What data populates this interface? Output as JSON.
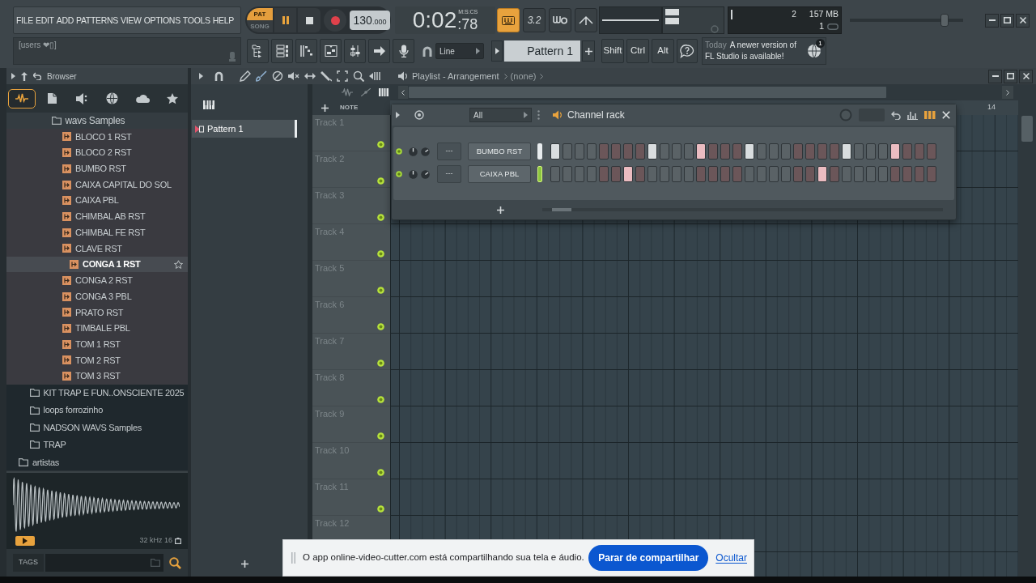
{
  "menu": [
    "FILE",
    "EDIT",
    "ADD",
    "PATTERNS",
    "VIEW",
    "OPTIONS",
    "TOOLS",
    "HELP"
  ],
  "hint_bar": {
    "text": "[users ❤▯]"
  },
  "transport": {
    "modes": [
      {
        "label": "PAT",
        "selected": true
      },
      {
        "label": "SONG",
        "selected": false
      }
    ],
    "playing": true,
    "recording": false,
    "tempo": "130",
    "tempo_fraction": ".000"
  },
  "time": {
    "value": "0:02",
    "fraction": ":78",
    "format": "M:S:CS"
  },
  "record_options": [
    {
      "kind": "keyboard",
      "on": true
    },
    {
      "kind": "countdown",
      "label": "3.2",
      "on": false
    },
    {
      "kind": "blend",
      "on": false
    },
    {
      "kind": "loop",
      "on": false
    }
  ],
  "monitor": {
    "cpu": "2",
    "memory": "157 MB",
    "polyphony": "1"
  },
  "master_volume": {
    "level": 0.86
  },
  "snap": {
    "value": "Line"
  },
  "pattern_selector": {
    "value": "Pattern 1"
  },
  "modifier_keys": [
    "Shift",
    "Ctrl",
    "Alt"
  ],
  "news": {
    "day": "Today",
    "message_lines": [
      "A newer version of",
      "FL Studio is available!"
    ],
    "count": "1"
  },
  "browser": {
    "title": "Browser",
    "tabs": [
      {
        "kind": "all",
        "selected": true
      },
      {
        "kind": "files",
        "selected": false
      },
      {
        "kind": "plugins",
        "selected": false
      },
      {
        "kind": "online",
        "selected": false
      },
      {
        "kind": "cloud",
        "selected": false
      },
      {
        "kind": "favorites",
        "selected": false
      }
    ],
    "tree": [
      {
        "children": [
          {
            "children": [
              {
                "children": [
                  {
                    "name": "wavs Samples",
                    "kind": "folder",
                    "selected": false,
                    "children": [
                      {
                        "name": "BLOCO 1 RST",
                        "kind": "audio",
                        "selected": false
                      },
                      {
                        "name": "BLOCO 2 RST",
                        "kind": "audio",
                        "selected": false
                      },
                      {
                        "name": "BUMBO RST",
                        "kind": "audio",
                        "selected": false
                      },
                      {
                        "name": "CAIXA CAPITAL DO SOL",
                        "kind": "audio",
                        "selected": false
                      },
                      {
                        "name": "CAIXA PBL",
                        "kind": "audio",
                        "selected": false
                      },
                      {
                        "name": "CHIMBAL AB RST",
                        "kind": "audio",
                        "selected": false
                      },
                      {
                        "name": "CHIMBAL FE RST",
                        "kind": "audio",
                        "selected": false
                      },
                      {
                        "name": "CLAVE RST",
                        "kind": "audio",
                        "selected": false
                      },
                      {
                        "name": "CONGA 1 RST",
                        "kind": "audio",
                        "selected": true
                      },
                      {
                        "name": "CONGA 2 RST",
                        "kind": "audio",
                        "selected": false
                      },
                      {
                        "name": "CONGA 3 PBL",
                        "kind": "audio",
                        "selected": false
                      },
                      {
                        "name": "PRATO RST",
                        "kind": "audio",
                        "selected": false
                      },
                      {
                        "name": "TIMBALE PBL",
                        "kind": "audio",
                        "selected": false
                      },
                      {
                        "name": "TOM 1 RST",
                        "kind": "audio",
                        "selected": false
                      },
                      {
                        "name": "TOM 2 RST",
                        "kind": "audio",
                        "selected": false
                      },
                      {
                        "name": "TOM 3 RST",
                        "kind": "audio",
                        "selected": false
                      }
                    ]
                  }
                ]
              }
            ]
          },
          {
            "name": "KIT TRAP E FUN..ONSCIENTE 2025",
            "kind": "folder",
            "selected": false
          },
          {
            "name": "loops forrozinho",
            "kind": "folder",
            "selected": false
          },
          {
            "name": "NADSON WAVS Samples",
            "kind": "folder",
            "selected": false
          },
          {
            "name": "TRAP",
            "kind": "folder",
            "selected": false
          }
        ]
      },
      {
        "name": "artistas",
        "kind": "folder",
        "selected": false
      }
    ]
  },
  "preview": {
    "info": "32 kHz 16"
  },
  "tags": {
    "label": "TAGS"
  },
  "patterns": [
    {
      "name": "Pattern 1",
      "selected": true
    }
  ],
  "playlist": {
    "title": "Playlist - Arrangement",
    "clip": "(none)",
    "header_label": "NOTE",
    "ruler": [
      "14"
    ],
    "tracks": [
      {
        "name": "Track 1",
        "enabled": true
      },
      {
        "name": "Track 2",
        "enabled": true
      },
      {
        "name": "Track 3",
        "enabled": true
      },
      {
        "name": "Track 4",
        "enabled": true
      },
      {
        "name": "Track 5",
        "enabled": true
      },
      {
        "name": "Track 6",
        "enabled": true
      },
      {
        "name": "Track 7",
        "enabled": true
      },
      {
        "name": "Track 8",
        "enabled": true
      },
      {
        "name": "Track 9",
        "enabled": true
      },
      {
        "name": "Track 10",
        "enabled": true
      },
      {
        "name": "Track 11",
        "enabled": true
      },
      {
        "name": "Track 12"
      }
    ]
  },
  "channel_rack": {
    "title": "Channel rack",
    "filter": "All",
    "channels": [
      {
        "name": "BUMBO RST",
        "on": true,
        "mixer_track": "---",
        "selected": false,
        "steps": [
          true,
          false,
          false,
          false,
          false,
          false,
          false,
          false,
          true,
          false,
          false,
          false,
          true,
          false,
          false,
          false,
          true,
          false,
          false,
          false,
          false,
          false,
          false,
          false,
          true,
          false,
          false,
          false,
          true,
          false,
          false,
          false
        ]
      },
      {
        "name": "CAIXA PBL",
        "on": true,
        "mixer_track": "---",
        "selected": true,
        "steps": [
          false,
          false,
          false,
          false,
          false,
          false,
          true,
          false,
          false,
          false,
          false,
          false,
          false,
          false,
          false,
          false,
          false,
          false,
          false,
          false,
          false,
          false,
          true,
          false,
          false,
          false,
          false,
          false,
          false,
          false,
          false,
          false
        ]
      }
    ]
  },
  "share_notice": {
    "message": "O app online-video-cutter.com está compartilhando sua tela e áudio.",
    "button": "Parar de compartilhar",
    "link": "Ocultar"
  }
}
